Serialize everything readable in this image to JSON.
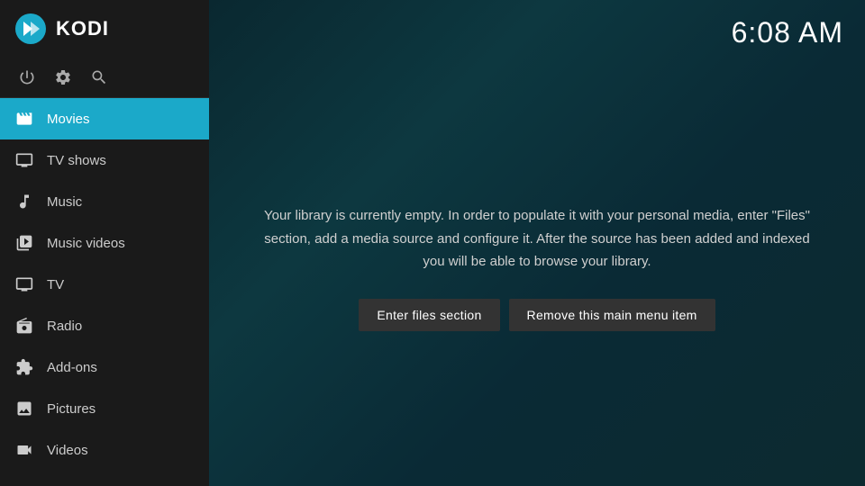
{
  "header": {
    "logo_alt": "KODI",
    "title": "KODI",
    "time": "6:08 AM"
  },
  "sidebar": {
    "icons": [
      {
        "name": "power-icon",
        "symbol": "⏻"
      },
      {
        "name": "settings-icon",
        "symbol": "⚙"
      },
      {
        "name": "search-icon",
        "symbol": "🔍"
      }
    ],
    "items": [
      {
        "id": "movies",
        "label": "Movies",
        "active": true
      },
      {
        "id": "tv-shows",
        "label": "TV shows",
        "active": false
      },
      {
        "id": "music",
        "label": "Music",
        "active": false
      },
      {
        "id": "music-videos",
        "label": "Music videos",
        "active": false
      },
      {
        "id": "tv",
        "label": "TV",
        "active": false
      },
      {
        "id": "radio",
        "label": "Radio",
        "active": false
      },
      {
        "id": "add-ons",
        "label": "Add-ons",
        "active": false
      },
      {
        "id": "pictures",
        "label": "Pictures",
        "active": false
      },
      {
        "id": "videos",
        "label": "Videos",
        "active": false
      }
    ]
  },
  "main": {
    "library_message": "Your library is currently empty. In order to populate it with your personal media, enter \"Files\" section, add a media source and configure it. After the source has been added and indexed you will be able to browse your library.",
    "btn_files": "Enter files section",
    "btn_remove": "Remove this main menu item"
  }
}
